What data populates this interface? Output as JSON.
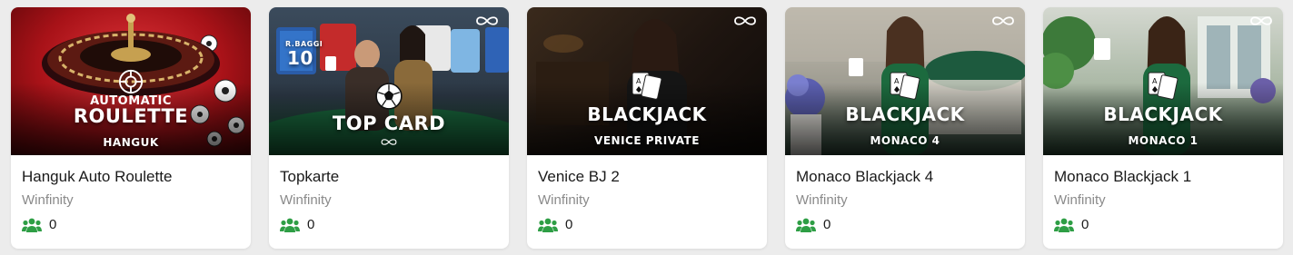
{
  "colors": {
    "accent_green": "#2e9e45",
    "card_bg": "#ffffff",
    "page_bg": "#ececec",
    "title_text": "#1a1a1a",
    "provider_text": "#8a8a8a"
  },
  "games": [
    {
      "name": "Hanguk Auto Roulette",
      "provider": "Winfinity",
      "players": "0",
      "thumb": {
        "top": "AUTOMATIC",
        "title": "ROULETTE",
        "subtitle": "HANGUK"
      },
      "icons": [
        "roulette-wheel-icon",
        "roulette-logo-icon"
      ]
    },
    {
      "name": "Topkarte",
      "provider": "Winfinity",
      "players": "0",
      "thumb": {
        "title": "TOP CARD",
        "jersey_name": "R.BAGGI",
        "jersey_number": "10"
      },
      "icons": [
        "soccer-ball-icon",
        "winfinity-logo-icon"
      ]
    },
    {
      "name": "Venice BJ 2",
      "provider": "Winfinity",
      "players": "0",
      "thumb": {
        "title": "BLACKJACK",
        "subtitle": "VENICE PRIVATE"
      },
      "icons": [
        "playing-cards-icon",
        "winfinity-logo-icon"
      ]
    },
    {
      "name": "Monaco Blackjack 4",
      "provider": "Winfinity",
      "players": "0",
      "thumb": {
        "title": "BLACKJACK",
        "subtitle": "MONACO 4"
      },
      "icons": [
        "playing-cards-icon",
        "winfinity-logo-icon"
      ]
    },
    {
      "name": "Monaco Blackjack 1",
      "provider": "Winfinity",
      "players": "0",
      "thumb": {
        "title": "BLACKJACK",
        "subtitle": "MONACO 1"
      },
      "icons": [
        "playing-cards-icon",
        "winfinity-logo-icon"
      ]
    }
  ]
}
